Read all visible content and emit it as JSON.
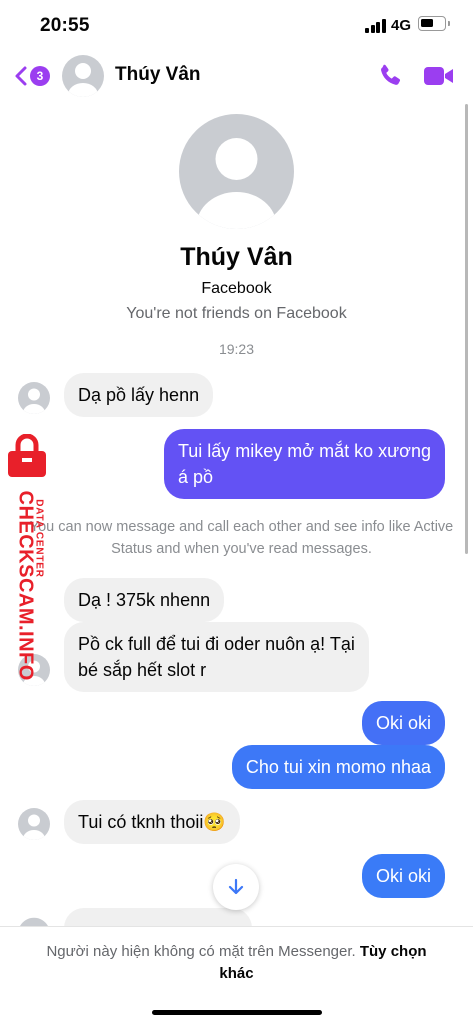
{
  "status_bar": {
    "time": "20:55",
    "network": "4G"
  },
  "header": {
    "back_badge": "3",
    "contact_name": "Thúy Vân"
  },
  "profile": {
    "name": "Thúy Vân",
    "subtitle": "Facebook",
    "note": "You're not friends on Facebook"
  },
  "conversation": {
    "timestamp": "19:23",
    "system_note": "You can now message and call each other and see info like Active Status and when you've read messages.",
    "messages": [
      {
        "from": "them",
        "text": "Dạ pồ lấy henn"
      },
      {
        "from": "me",
        "line1": "Tui lấy mikey mở mắt ko xương",
        "line2": "á pồ"
      },
      {
        "from": "them",
        "text": "Dạ ! 375k nhenn"
      },
      {
        "from": "them",
        "line1": "Pồ ck full để tui đi oder nuôn ạ! Tại",
        "line2": "bé sắp hết slot r"
      },
      {
        "from": "me",
        "text": "Oki oki"
      },
      {
        "from": "me",
        "text": "Cho tui xin momo nhaa"
      },
      {
        "from": "them",
        "text": "Tui có tknh thoii🥺"
      },
      {
        "from": "me",
        "text": "Oki oki"
      }
    ]
  },
  "footer": {
    "notice": "Người này hiện không có mặt trên Messenger.",
    "link": "Tùy chọn khác"
  },
  "watermark": {
    "main": "CHECKSCAM.INFO",
    "sub": "DATA CENTER"
  },
  "colors": {
    "accent": "#9b3ef0",
    "outgoing_top": "#7a4ef2",
    "outgoing_bottom": "#3d78f7",
    "incoming": "#f0f0f0",
    "watermark_red": "#e8202a"
  },
  "icons": [
    "back-chevron-icon",
    "phone-icon",
    "video-camera-icon",
    "default-avatar-icon",
    "arrow-down-icon",
    "padlock-icon"
  ]
}
